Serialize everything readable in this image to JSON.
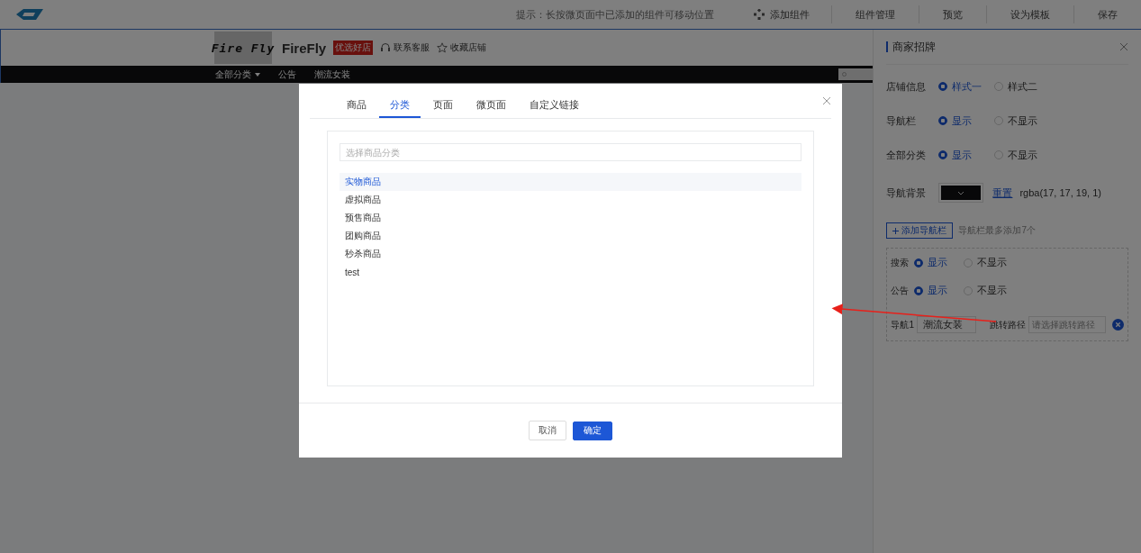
{
  "top_bar": {
    "hint": "提示：长按微页面中已添加的组件可移动位置",
    "actions": [
      {
        "label": "添加组件",
        "kind": "icon"
      },
      {
        "label": "组件管理",
        "kind": "plain"
      },
      {
        "label": "预览",
        "kind": "plain"
      },
      {
        "label": "设为模板",
        "kind": "plain"
      },
      {
        "label": "保存",
        "kind": "plain"
      }
    ]
  },
  "store_header": {
    "logo_text": "Fire Fly",
    "name": "FireFly",
    "badge": "优选好店",
    "links": [
      {
        "label": "联系客服",
        "kind": "service"
      },
      {
        "label": "收藏店铺",
        "kind": "star"
      }
    ],
    "nav": [
      {
        "label": "全部分类",
        "dropdown": true
      },
      {
        "label": "公告",
        "dropdown": false
      },
      {
        "label": "潮流女装",
        "dropdown": false
      }
    ]
  },
  "right_panel": {
    "title": "商家招牌",
    "settings": [
      {
        "label": "店铺信息",
        "kind": "radio",
        "options": [
          {
            "label": "样式一",
            "selected": true
          },
          {
            "label": "样式二",
            "selected": false
          }
        ]
      },
      {
        "label": "导航栏",
        "kind": "radio",
        "options": [
          {
            "label": "显示",
            "selected": true
          },
          {
            "label": "不显示",
            "selected": false
          }
        ]
      },
      {
        "label": "全部分类",
        "kind": "radio",
        "options": [
          {
            "label": "显示",
            "selected": true
          },
          {
            "label": "不显示",
            "selected": false
          }
        ]
      },
      {
        "label": "导航背景",
        "kind": "color",
        "color": "#111113",
        "reset": "重置",
        "value": "rgba(17, 17, 19, 1)"
      }
    ],
    "add_button": "添加导航栏",
    "add_hint": "导航栏最多添加7个",
    "nav_box": {
      "settings": [
        {
          "label": "搜索",
          "options": [
            {
              "label": "显示",
              "selected": true
            },
            {
              "label": "不显示",
              "selected": false
            }
          ]
        },
        {
          "label": "公告",
          "options": [
            {
              "label": "显示",
              "selected": true
            },
            {
              "label": "不显示",
              "selected": false
            }
          ]
        }
      ],
      "nav_items": [
        {
          "label": "导航1",
          "value": "潮流女装",
          "path_label": "跳转路径",
          "path_placeholder": "请选择跳转路径"
        }
      ]
    }
  },
  "dialog": {
    "tabs": [
      {
        "label": "商品",
        "selected": false
      },
      {
        "label": "分类",
        "selected": true
      },
      {
        "label": "页面",
        "selected": false
      },
      {
        "label": "微页面",
        "selected": false
      },
      {
        "label": "自定义链接",
        "selected": false
      }
    ],
    "search_placeholder": "选择商品分类",
    "categories": [
      {
        "label": "实物商品",
        "selected": true
      },
      {
        "label": "虚拟商品",
        "selected": false
      },
      {
        "label": "预售商品",
        "selected": false
      },
      {
        "label": "团购商品",
        "selected": false
      },
      {
        "label": "秒杀商品",
        "selected": false
      },
      {
        "label": "test",
        "selected": false
      }
    ],
    "buttons": [
      {
        "label": "取消",
        "kind": "secondary"
      },
      {
        "label": "确定",
        "kind": "primary"
      }
    ]
  }
}
